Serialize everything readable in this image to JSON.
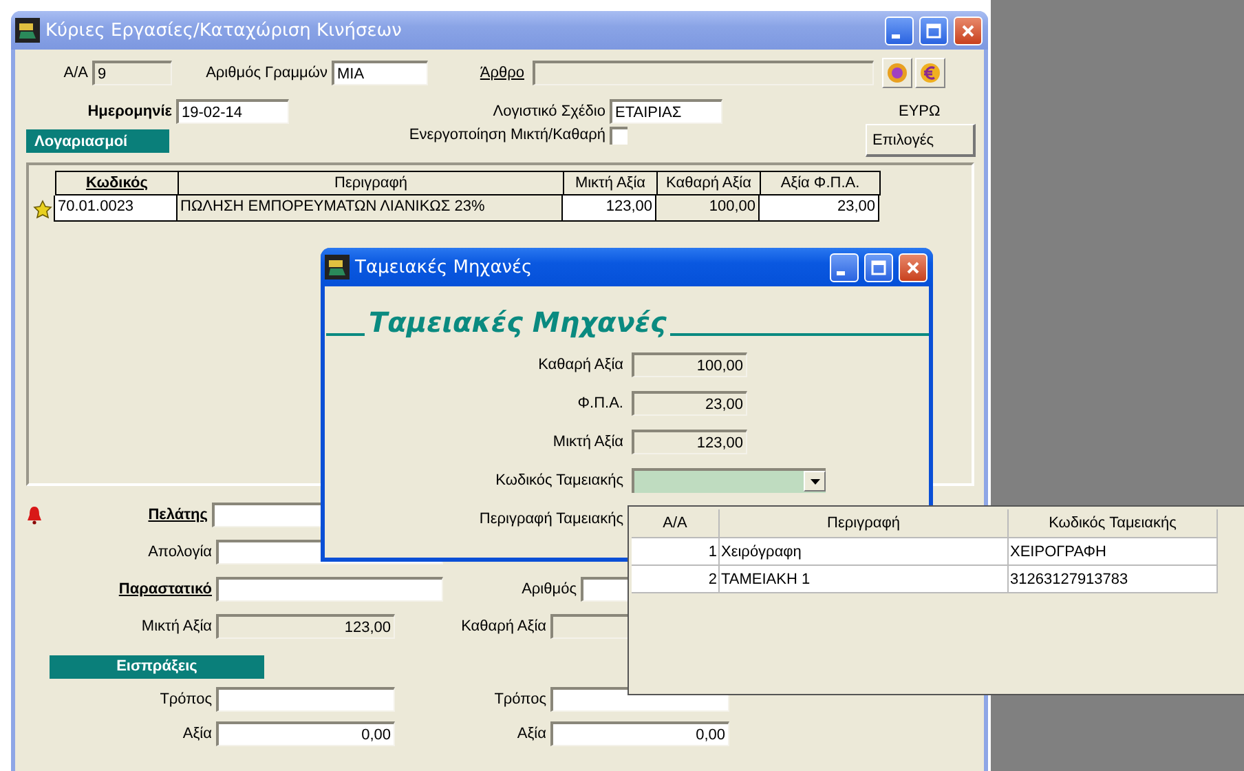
{
  "main_window": {
    "title": "Κύριες Εργασίες/Καταχώριση Κινήσεων",
    "aa": {
      "label": "Α/Α",
      "value": "9"
    },
    "lines": {
      "label": "Αριθμός Γραμμών",
      "value": "ΜΙΑ"
    },
    "article": {
      "label": "Άρθρο"
    },
    "date": {
      "label": "Ημερομηνίε",
      "value": "19-02-14"
    },
    "chart_of_accounts": {
      "label": "Λογιστικό Σχέδιο",
      "value": "ΕΤΑΙΡΙΑΣ"
    },
    "currency": "ΕΥΡΩ",
    "gross_net": {
      "label": "Ενεργοποίηση Μικτή/Καθαρή",
      "checked": false
    },
    "options_button": "Επιλογές",
    "accounts_tab": "Λογαριασμοί",
    "table": {
      "columns": [
        {
          "label": "Κωδικός",
          "key": true
        },
        {
          "label": "Περιγραφή",
          "key": false
        },
        {
          "label": "Μικτή Αξία",
          "key": false
        },
        {
          "label": "Καθαρή Αξία",
          "key": false
        },
        {
          "label": "Αξία Φ.Π.Α.",
          "key": false
        }
      ],
      "rows": [
        {
          "cells": [
            "70.01.0023",
            "ΠΩΛΗΣΗ ΕΜΠΟΡΕΥΜΑΤΩΝ ΛΙΑΝΙΚΩΣ 23%",
            "123,00",
            "100,00",
            "23,00"
          ]
        }
      ]
    },
    "customer": {
      "label": "Πελάτης"
    },
    "reason": {
      "label": "Απολογία"
    },
    "document": {
      "label": "Παραστατικό"
    },
    "number": {
      "label": "Αριθμός"
    },
    "gross": {
      "label": "Μικτή Αξία",
      "value": "123,00"
    },
    "net": {
      "label": "Καθαρή Αξία"
    },
    "receipts_header": "Εισπράξεις",
    "receipts": [
      {
        "method_label": "Τρόπος",
        "amount_label": "Αξία",
        "amount": "0,00"
      },
      {
        "method_label": "Τρόπος",
        "amount_label": "Αξία",
        "amount": "0,00"
      }
    ]
  },
  "dialog": {
    "title": "Ταμειακές Μηχανές",
    "heading": "Ταμειακές Μηχανές",
    "fields": [
      {
        "label": "Καθαρή Αξία",
        "value": "100,00"
      },
      {
        "label": "Φ.Π.Α.",
        "value": "23,00"
      },
      {
        "label": "Μικτή Αξία",
        "value": "123,00"
      }
    ],
    "register_code": {
      "label": "Κωδικός Ταμειακής"
    },
    "register_description": {
      "label": "Περιγραφή Ταμειακής"
    }
  },
  "dropdown": {
    "columns": [
      "Α/Α",
      "Περιγραφή",
      "Κωδικός Ταμειακής"
    ],
    "rows": [
      [
        "1",
        "Χειρόγραφη",
        "ΧΕΙΡΟΓΡΑΦΗ"
      ],
      [
        "2",
        "ΤΑΜΕΙΑΚΗ 1",
        "31263127913783"
      ]
    ]
  }
}
